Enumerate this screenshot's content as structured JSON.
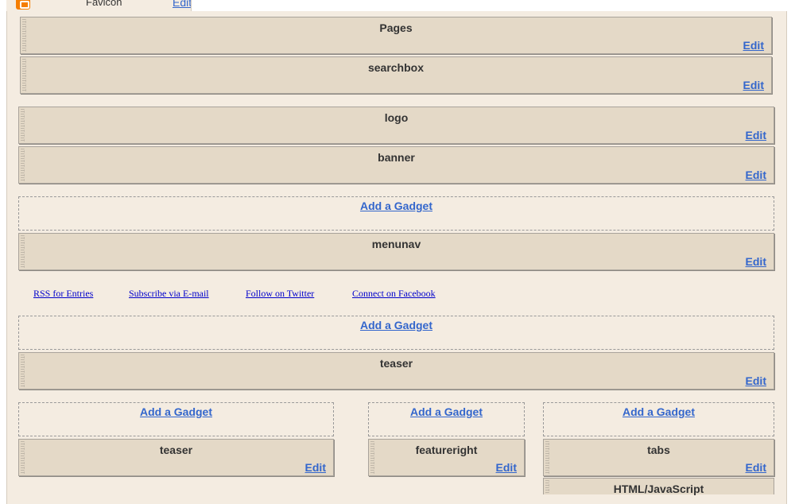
{
  "header": {
    "favicon_label": "Favicon",
    "favicon_edit": "Edit"
  },
  "widgets": {
    "pages": {
      "title": "Pages",
      "edit": "Edit"
    },
    "searchbox": {
      "title": "searchbox",
      "edit": "Edit"
    },
    "logo": {
      "title": "logo",
      "edit": "Edit"
    },
    "banner": {
      "title": "banner",
      "edit": "Edit"
    },
    "menunav": {
      "title": "menunav",
      "edit": "Edit"
    },
    "teaser_main": {
      "title": "teaser",
      "edit": "Edit"
    },
    "teaser_left": {
      "title": "teaser",
      "edit": "Edit"
    },
    "featureright": {
      "title": "featureright",
      "edit": "Edit"
    },
    "tabs": {
      "title": "tabs",
      "edit": "Edit"
    },
    "html_js": {
      "title": "HTML/JavaScript"
    }
  },
  "add_gadget": "Add a Gadget",
  "social_links": [
    "RSS for Entries",
    "Subscribe via E-mail",
    "Follow on Twitter",
    "Connect on Facebook"
  ]
}
